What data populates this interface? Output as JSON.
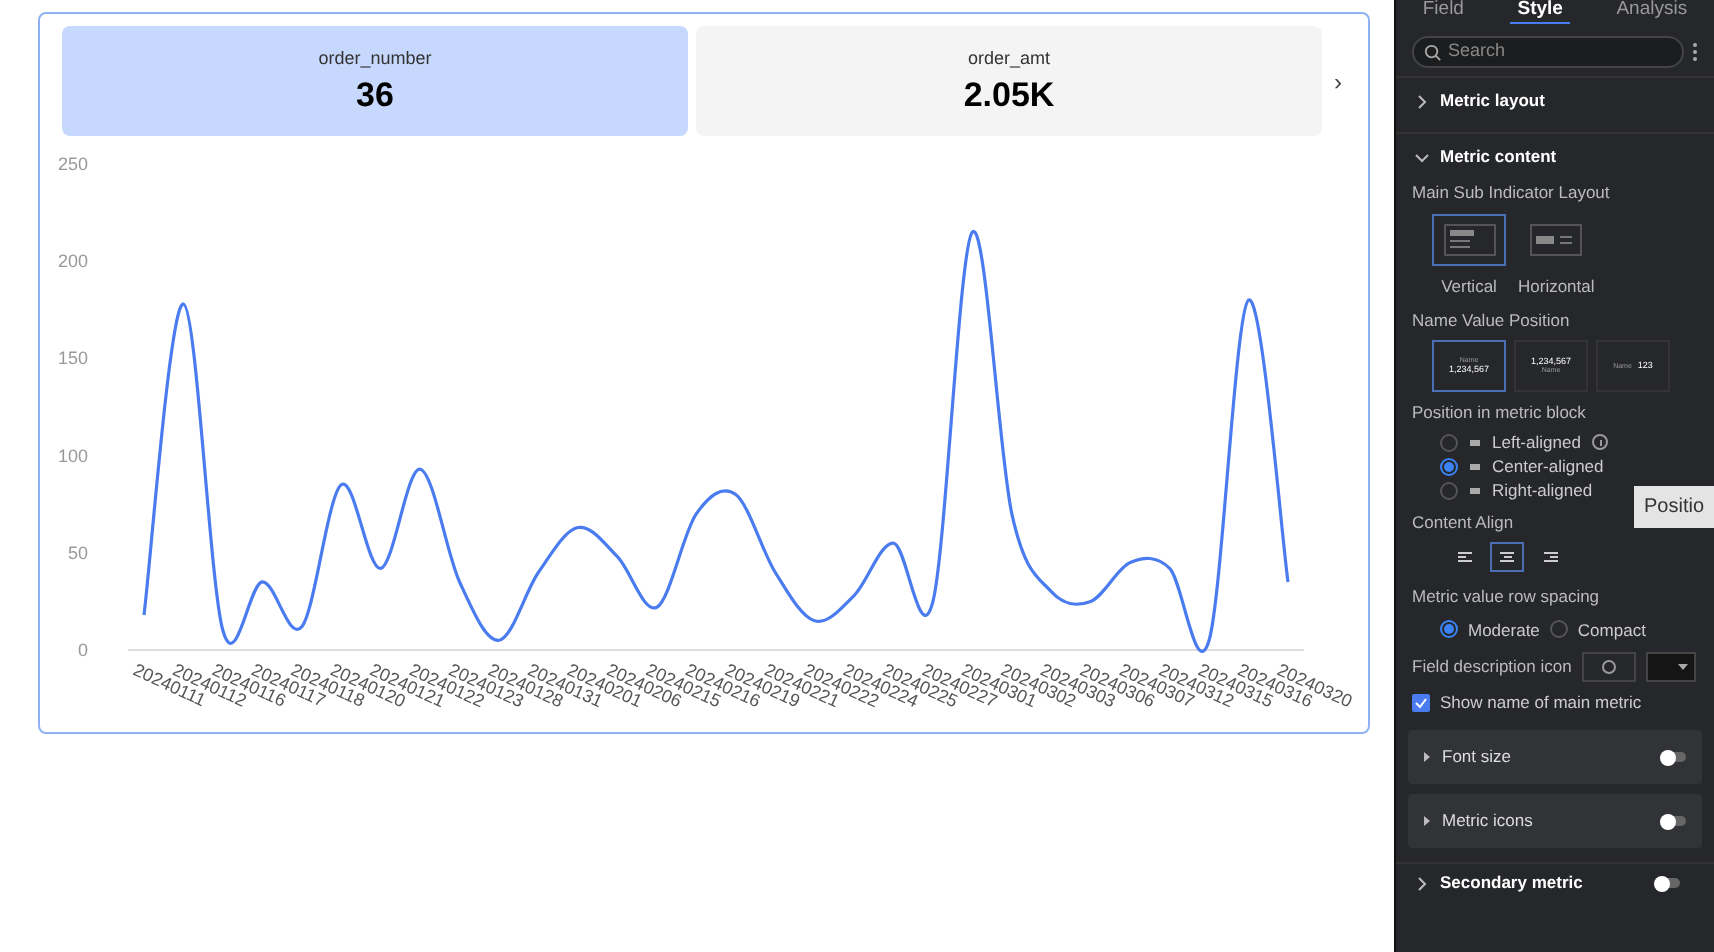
{
  "metric_cards": [
    {
      "name": "order_number",
      "value": "36",
      "selected": true
    },
    {
      "name": "order_amt",
      "value": "2.05K",
      "selected": false
    }
  ],
  "next_arrow": "›",
  "chart_data": {
    "type": "line",
    "categories": [
      "20240111",
      "20240112",
      "20240116",
      "20240117",
      "20240118",
      "20240120",
      "20240121",
      "20240122",
      "20240123",
      "20240128",
      "20240131",
      "20240201",
      "20240206",
      "20240215",
      "20240216",
      "20240219",
      "20240221",
      "20240222",
      "20240224",
      "20240225",
      "20240227",
      "20240301",
      "20240302",
      "20240303",
      "20240306",
      "20240307",
      "20240312",
      "20240315",
      "20240316",
      "20240320"
    ],
    "series": [
      {
        "color": "#4a7cf0",
        "values": [
          18,
          178,
          10,
          35,
          12,
          85,
          42,
          93,
          35,
          5,
          40,
          63,
          48,
          22,
          70,
          80,
          40,
          15,
          28,
          55,
          25,
          215,
          70,
          30,
          25,
          45,
          42,
          5,
          180,
          35
        ]
      }
    ],
    "ylim": [
      0,
      250
    ],
    "yticks": [
      0,
      50,
      100,
      150,
      200,
      250
    ]
  },
  "panel": {
    "tabs": [
      {
        "label": "Field",
        "selected": false
      },
      {
        "label": "Style",
        "selected": true
      },
      {
        "label": "Analysis",
        "selected": false
      }
    ],
    "search": {
      "placeholder": "Search"
    },
    "metric_layout": {
      "label": "Metric layout",
      "expanded": false
    },
    "metric_content": {
      "label": "Metric content",
      "expanded": true
    },
    "layout_label": "Main Sub Indicator Layout",
    "layouts": [
      {
        "label": "Vertical",
        "kind": "vertical",
        "selected": true
      },
      {
        "label": "Horizontal",
        "kind": "horizontal",
        "selected": false
      }
    ],
    "name_value_label": "Name Value Position",
    "name_value_options": [
      {
        "kind": "name-above",
        "name": "Name",
        "value": "1,234,567",
        "selected": true
      },
      {
        "kind": "name-below",
        "name": "Name",
        "value": "1,234,567",
        "selected": false
      },
      {
        "kind": "name-left",
        "name": "Name",
        "value": "123",
        "selected": false
      }
    ],
    "position_label": "Position in metric block",
    "positions": [
      {
        "label": "Left-aligned",
        "selected": false,
        "info": true
      },
      {
        "label": "Center-aligned",
        "selected": true,
        "info": false
      },
      {
        "label": "Right-aligned",
        "selected": false,
        "info": false
      }
    ],
    "tooltip": "Positio",
    "content_align_label": "Content Align",
    "content_aligns": [
      {
        "kind": "left",
        "selected": false
      },
      {
        "kind": "center",
        "selected": true
      },
      {
        "kind": "right",
        "selected": false
      }
    ],
    "spacing_label": "Metric value row spacing",
    "spacings": [
      {
        "label": "Moderate",
        "selected": true
      },
      {
        "label": "Compact",
        "selected": false
      }
    ],
    "field_desc_label": "Field description icon",
    "show_name": {
      "label": "Show name of main metric",
      "checked": true
    },
    "subsections": [
      {
        "label": "Font size",
        "on": false
      },
      {
        "label": "Metric icons",
        "on": false
      }
    ],
    "secondary": {
      "label": "Secondary metric",
      "on": false
    }
  }
}
